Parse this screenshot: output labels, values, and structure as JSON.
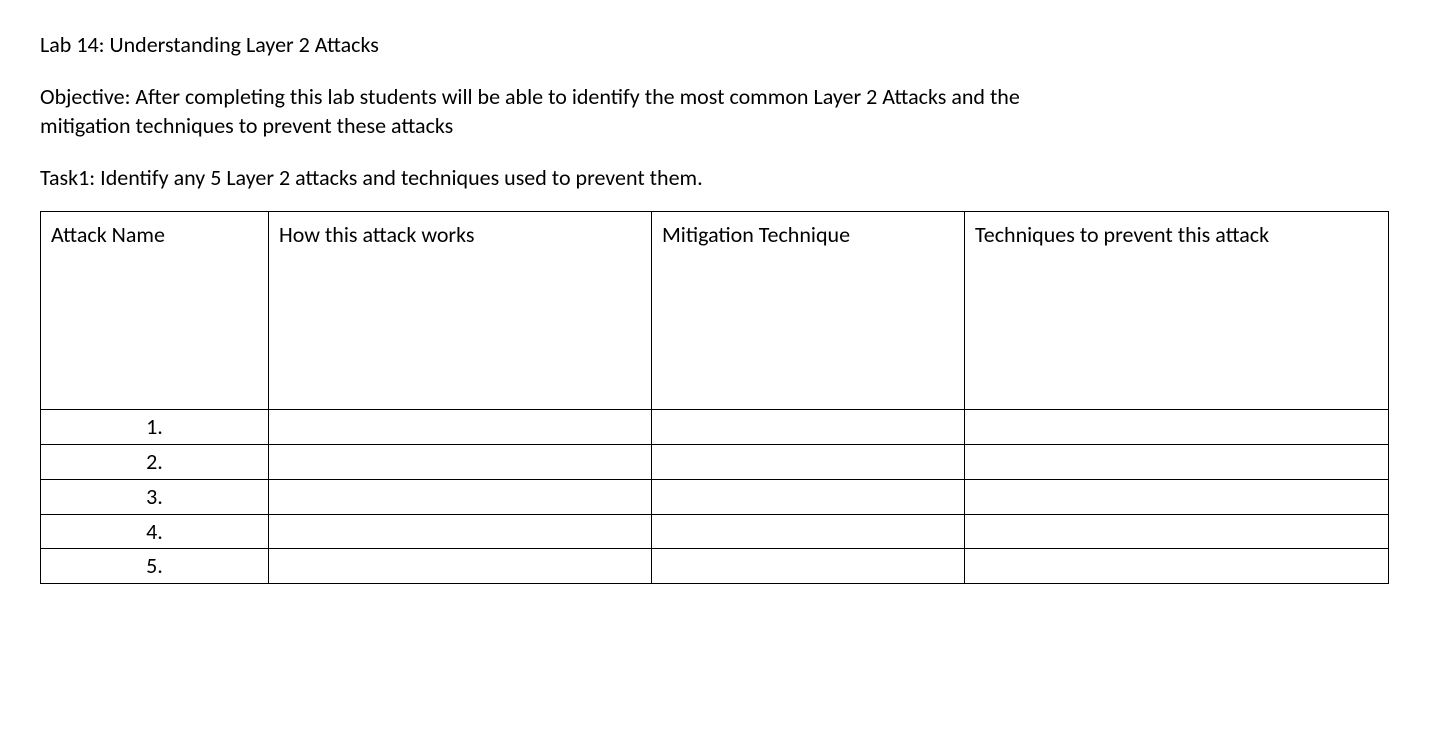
{
  "title": "Lab 14: Understanding Layer 2 Attacks",
  "objective": "Objective: After completing this lab students will be able to identify the most common Layer 2 Attacks and the mitigation techniques to prevent these attacks",
  "task": "Task1: Identify any 5 Layer 2 attacks and techniques used to prevent them.",
  "table": {
    "headers": {
      "attack_name": "Attack Name",
      "how_works": "How this attack works",
      "mitigation": "Mitigation Technique",
      "techniques": "Techniques to prevent this attack"
    },
    "rows": [
      {
        "num": "1.",
        "attack_name": "",
        "how_works": "",
        "mitigation": "",
        "techniques": ""
      },
      {
        "num": "2.",
        "attack_name": "",
        "how_works": "",
        "mitigation": "",
        "techniques": ""
      },
      {
        "num": "3.",
        "attack_name": "",
        "how_works": "",
        "mitigation": "",
        "techniques": ""
      },
      {
        "num": "4.",
        "attack_name": "",
        "how_works": "",
        "mitigation": "",
        "techniques": ""
      },
      {
        "num": "5.",
        "attack_name": "",
        "how_works": "",
        "mitigation": "",
        "techniques": ""
      }
    ]
  }
}
